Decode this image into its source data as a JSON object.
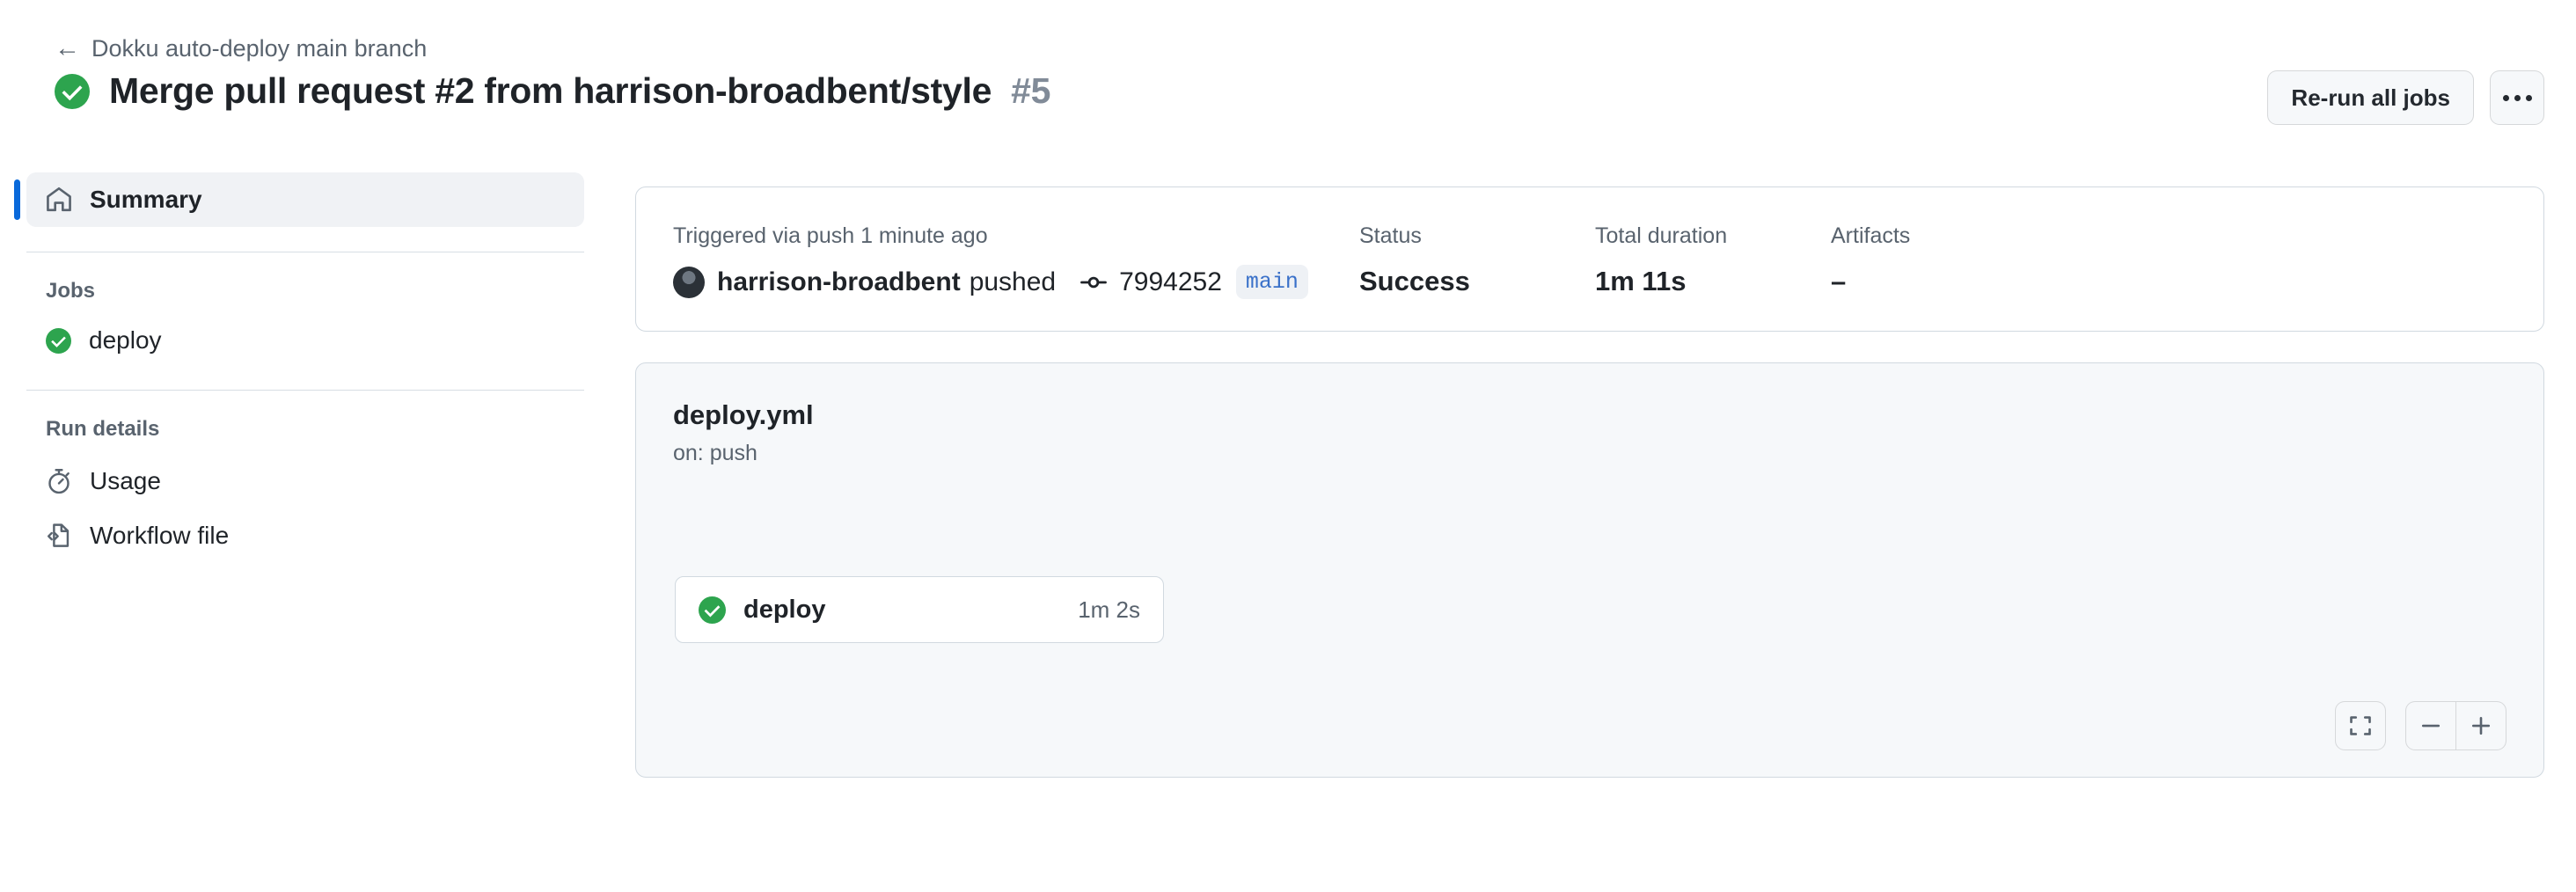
{
  "header": {
    "breadcrumb": {
      "back_icon": "arrow-left-icon",
      "label": "Dokku auto-deploy main branch"
    },
    "status_icon": "check-circle-success-icon",
    "title": "Merge pull request #2 from harrison-broadbent/style",
    "run_number": "#5",
    "rerun_button": "Re-run all jobs",
    "more_menu_icon": "kebab-horizontal-icon"
  },
  "sidebar": {
    "summary": {
      "label": "Summary",
      "icon": "home-icon"
    },
    "jobs_heading": "Jobs",
    "jobs": [
      {
        "label": "deploy",
        "icon": "check-circle-success-icon"
      }
    ],
    "run_details_heading": "Run details",
    "run_details": [
      {
        "label": "Usage",
        "icon": "stopwatch-icon"
      },
      {
        "label": "Workflow file",
        "icon": "file-code-icon"
      }
    ]
  },
  "info_card": {
    "trigger_label": "Triggered via push 1 minute ago",
    "avatar_icon": "user-avatar",
    "actor": "harrison-broadbent",
    "action": "pushed",
    "commit_icon": "git-commit-icon",
    "commit_sha": "7994252",
    "branch": "main",
    "status_label": "Status",
    "status_value": "Success",
    "duration_label": "Total duration",
    "duration_value": "1m 11s",
    "artifacts_label": "Artifacts",
    "artifacts_value": "–"
  },
  "graph": {
    "workflow_file": "deploy.yml",
    "trigger": "on: push",
    "node": {
      "status_icon": "check-circle-success-icon",
      "label": "deploy",
      "duration": "1m 2s"
    },
    "controls": {
      "fit_icon": "fit-to-screen-icon",
      "zoom_out_icon": "minus-icon",
      "zoom_in_icon": "plus-icon"
    }
  },
  "colors": {
    "success_green": "#2da44e",
    "accent_blue": "#0969da",
    "branch_blue": "#3a71c9",
    "muted_text": "#59636e",
    "card_border": "#d1d9e0",
    "canvas_gray": "#f6f8fa"
  }
}
